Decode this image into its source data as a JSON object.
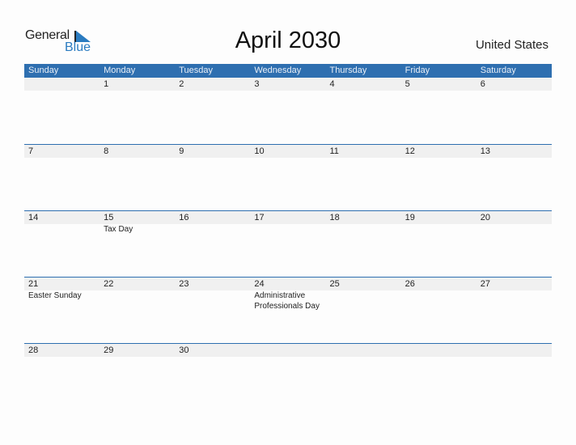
{
  "logo": {
    "text_general": "General",
    "text_blue": "Blue",
    "accent_color": "#2a7bc0"
  },
  "title": "April 2030",
  "country": "United States",
  "header_color": "#2e6fb0",
  "weekdays": [
    "Sunday",
    "Monday",
    "Tuesday",
    "Wednesday",
    "Thursday",
    "Friday",
    "Saturday"
  ],
  "weeks": [
    [
      {
        "day": "",
        "events": []
      },
      {
        "day": "1",
        "events": []
      },
      {
        "day": "2",
        "events": []
      },
      {
        "day": "3",
        "events": []
      },
      {
        "day": "4",
        "events": []
      },
      {
        "day": "5",
        "events": []
      },
      {
        "day": "6",
        "events": []
      }
    ],
    [
      {
        "day": "7",
        "events": []
      },
      {
        "day": "8",
        "events": []
      },
      {
        "day": "9",
        "events": []
      },
      {
        "day": "10",
        "events": []
      },
      {
        "day": "11",
        "events": []
      },
      {
        "day": "12",
        "events": []
      },
      {
        "day": "13",
        "events": []
      }
    ],
    [
      {
        "day": "14",
        "events": []
      },
      {
        "day": "15",
        "events": [
          "Tax Day"
        ]
      },
      {
        "day": "16",
        "events": []
      },
      {
        "day": "17",
        "events": []
      },
      {
        "day": "18",
        "events": []
      },
      {
        "day": "19",
        "events": []
      },
      {
        "day": "20",
        "events": []
      }
    ],
    [
      {
        "day": "21",
        "events": [
          "Easter Sunday"
        ]
      },
      {
        "day": "22",
        "events": []
      },
      {
        "day": "23",
        "events": []
      },
      {
        "day": "24",
        "events": [
          "Administrative Professionals Day"
        ]
      },
      {
        "day": "25",
        "events": []
      },
      {
        "day": "26",
        "events": []
      },
      {
        "day": "27",
        "events": []
      }
    ],
    [
      {
        "day": "28",
        "events": []
      },
      {
        "day": "29",
        "events": []
      },
      {
        "day": "30",
        "events": []
      },
      {
        "day": "",
        "events": []
      },
      {
        "day": "",
        "events": []
      },
      {
        "day": "",
        "events": []
      },
      {
        "day": "",
        "events": []
      }
    ]
  ]
}
